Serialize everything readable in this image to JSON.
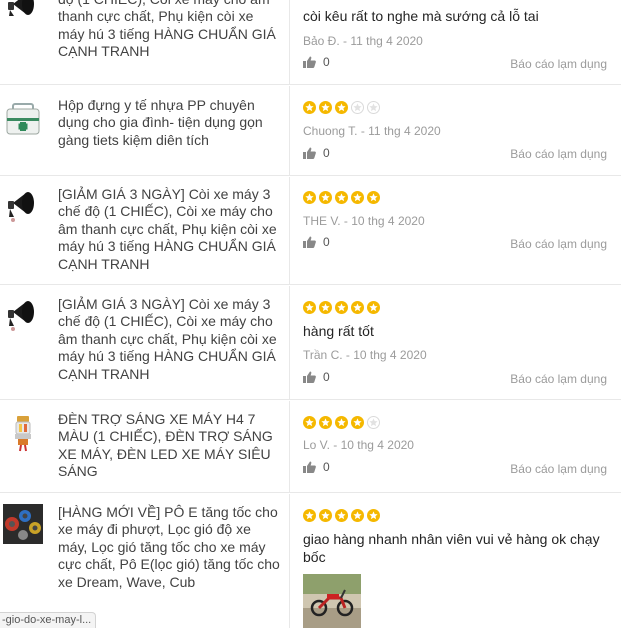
{
  "reviews": [
    {
      "product": "độ (1 CHIẾC), Còi xe máy cho âm thanh cực chất, Phụ kiện còi xe máy hú 3 tiếng HÀNG CHUẨN GIÁ CẠNH TRANH",
      "thumb_icon": "horn-icon",
      "stars": 0,
      "text": "còi kêu rất to nghe mà sướng cả lỗ tai",
      "meta": "Bảo Đ. - 11 thg 4 2020",
      "likes": "0",
      "report": "Báo cáo lạm dụng"
    },
    {
      "product": "Hộp đựng y tế nhựa PP chuyên dụng cho gia đình- tiện dụng gọn gàng tiets kiệm diên tích",
      "thumb_icon": "medical-box-icon",
      "stars": 3,
      "text": "",
      "meta": "Chuong T. - 11 thg 4 2020",
      "likes": "0",
      "report": "Báo cáo lạm dụng"
    },
    {
      "product": "[GIẢM GIÁ 3 NGÀY] Còi xe máy 3 chế độ (1 CHIẾC), Còi xe máy cho âm thanh cực chất, Phụ kiện còi xe máy hú 3 tiếng HÀNG CHUẨN GIÁ CẠNH TRANH",
      "thumb_icon": "horn-icon",
      "stars": 5,
      "text": "",
      "meta": "THE V. - 10 thg 4 2020",
      "likes": "0",
      "report": "Báo cáo lạm dụng"
    },
    {
      "product": "[GIẢM GIÁ 3 NGÀY] Còi xe máy 3 chế độ (1 CHIẾC), Còi xe máy cho âm thanh cực chất, Phụ kiện còi xe máy hú 3 tiếng HÀNG CHUẨN GIÁ CẠNH TRANH",
      "thumb_icon": "horn-icon",
      "stars": 5,
      "text": "hàng rất tốt",
      "meta": "Trần C. - 10 thg 4 2020",
      "likes": "0",
      "report": "Báo cáo lạm dụng"
    },
    {
      "product": "ĐÈN TRỢ SÁNG XE MÁY H4 7 MÀU (1 CHIẾC), ĐÈN TRỢ SÁNG XE MÁY, ĐÈN LED XE MÁY SIÊU SÁNG",
      "thumb_icon": "led-bulb-icon",
      "stars": 4,
      "text": "",
      "meta": "Lo V. - 10 thg 4 2020",
      "likes": "0",
      "report": "Báo cáo lạm dụng"
    },
    {
      "product": "[HÀNG MỚI VỀ] PÔ E tăng tốc cho xe máy đi phượt, Lọc gió độ xe máy, Lọc gió tăng tốc cho xe máy cực chất, Pô E(lọc gió) tăng tốc cho xe Dream, Wave, Cub",
      "thumb_icon": "air-filter-icon",
      "stars": 5,
      "text": "giao hàng nhanh nhân viên vui vẻ hàng ok chạy bốc",
      "meta": "",
      "likes": "",
      "report": "",
      "photo_icon": "motorbike-photo-icon"
    }
  ],
  "status_url": "-gio-do-xe-may-l..."
}
